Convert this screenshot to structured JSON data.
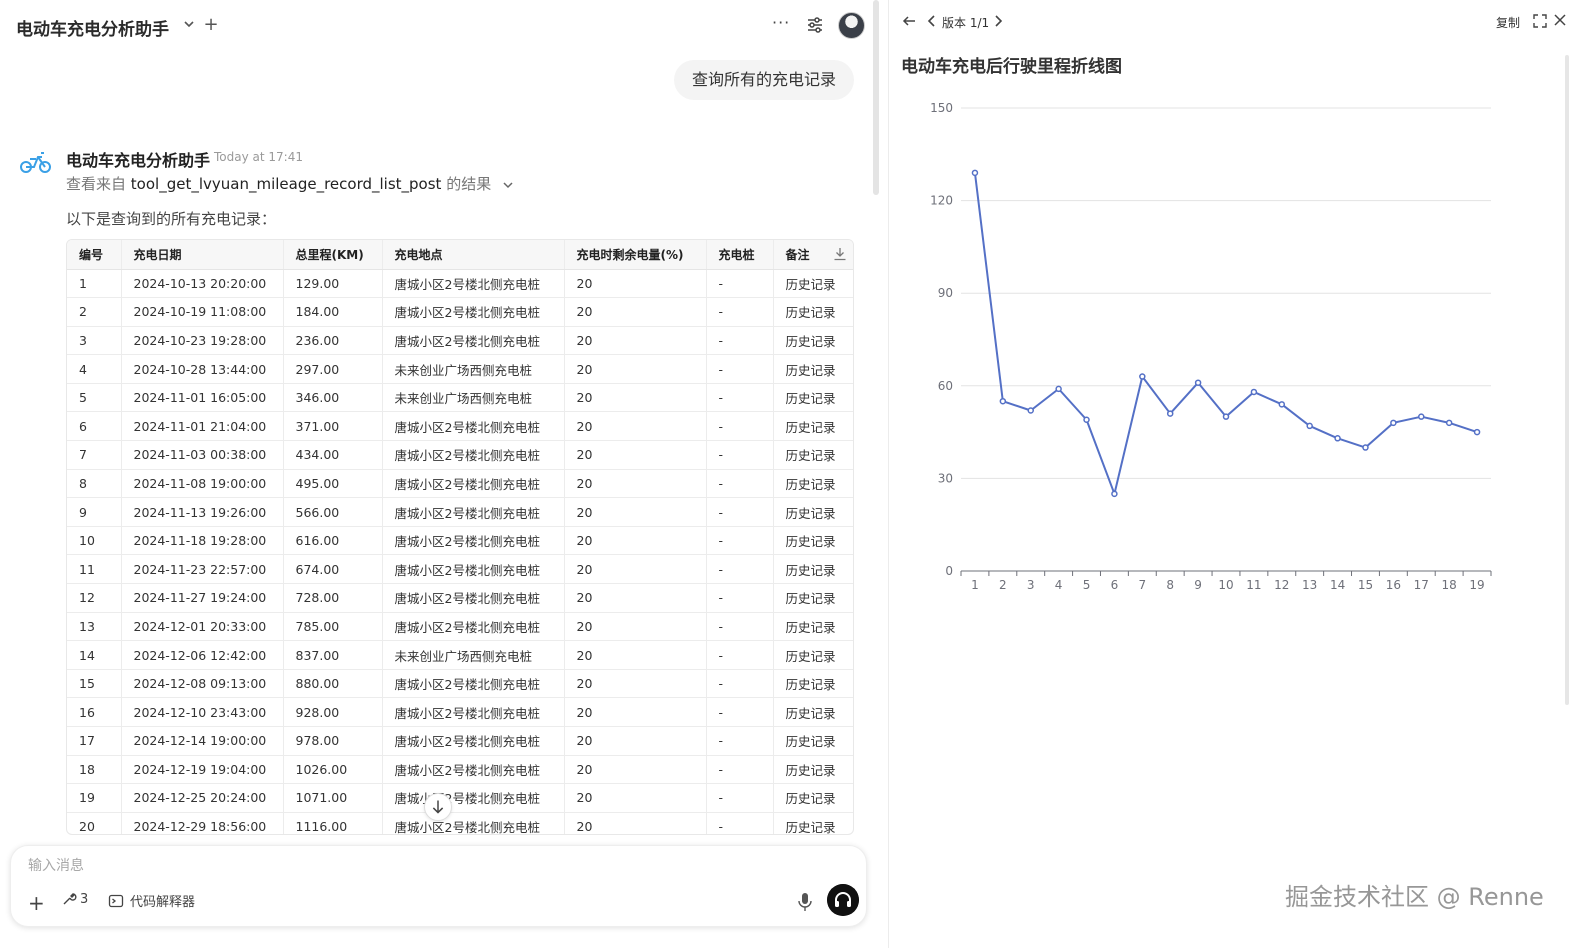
{
  "header": {
    "app_title": "电动车充电分析助手",
    "new_tab": "+",
    "more": "···"
  },
  "messages": {
    "user_query": "查询所有的充电记录",
    "bot_name": "电动车充电分析助手",
    "bot_time": "Today at 17:41",
    "tool_prefix": "查看来自",
    "tool_name": "tool_get_lvyuan_mileage_record_list_post",
    "tool_suffix": "的结果",
    "intro": "以下是查询到的所有充电记录："
  },
  "table": {
    "columns": [
      "编号",
      "充电日期",
      "总里程(KM)",
      "充电地点",
      "充电时剩余电量(%)",
      "充电桩",
      "备注"
    ],
    "rows": [
      [
        "1",
        "2024-10-13 20:20:00",
        "129.00",
        "唐城小区2号楼北侧充电桩",
        "20",
        "-",
        "历史记录"
      ],
      [
        "2",
        "2024-10-19 11:08:00",
        "184.00",
        "唐城小区2号楼北侧充电桩",
        "20",
        "-",
        "历史记录"
      ],
      [
        "3",
        "2024-10-23 19:28:00",
        "236.00",
        "唐城小区2号楼北侧充电桩",
        "20",
        "-",
        "历史记录"
      ],
      [
        "4",
        "2024-10-28 13:44:00",
        "297.00",
        "未来创业广场西侧充电桩",
        "20",
        "-",
        "历史记录"
      ],
      [
        "5",
        "2024-11-01 16:05:00",
        "346.00",
        "未来创业广场西侧充电桩",
        "20",
        "-",
        "历史记录"
      ],
      [
        "6",
        "2024-11-01 21:04:00",
        "371.00",
        "唐城小区2号楼北侧充电桩",
        "20",
        "-",
        "历史记录"
      ],
      [
        "7",
        "2024-11-03 00:38:00",
        "434.00",
        "唐城小区2号楼北侧充电桩",
        "20",
        "-",
        "历史记录"
      ],
      [
        "8",
        "2024-11-08 19:00:00",
        "495.00",
        "唐城小区2号楼北侧充电桩",
        "20",
        "-",
        "历史记录"
      ],
      [
        "9",
        "2024-11-13 19:26:00",
        "566.00",
        "唐城小区2号楼北侧充电桩",
        "20",
        "-",
        "历史记录"
      ],
      [
        "10",
        "2024-11-18 19:28:00",
        "616.00",
        "唐城小区2号楼北侧充电桩",
        "20",
        "-",
        "历史记录"
      ],
      [
        "11",
        "2024-11-23 22:57:00",
        "674.00",
        "唐城小区2号楼北侧充电桩",
        "20",
        "-",
        "历史记录"
      ],
      [
        "12",
        "2024-11-27 19:24:00",
        "728.00",
        "唐城小区2号楼北侧充电桩",
        "20",
        "-",
        "历史记录"
      ],
      [
        "13",
        "2024-12-01 20:33:00",
        "785.00",
        "唐城小区2号楼北侧充电桩",
        "20",
        "-",
        "历史记录"
      ],
      [
        "14",
        "2024-12-06 12:42:00",
        "837.00",
        "未来创业广场西侧充电桩",
        "20",
        "-",
        "历史记录"
      ],
      [
        "15",
        "2024-12-08 09:13:00",
        "880.00",
        "唐城小区2号楼北侧充电桩",
        "20",
        "-",
        "历史记录"
      ],
      [
        "16",
        "2024-12-10 23:43:00",
        "928.00",
        "唐城小区2号楼北侧充电桩",
        "20",
        "-",
        "历史记录"
      ],
      [
        "17",
        "2024-12-14 19:00:00",
        "978.00",
        "唐城小区2号楼北侧充电桩",
        "20",
        "-",
        "历史记录"
      ],
      [
        "18",
        "2024-12-19 19:04:00",
        "1026.00",
        "唐城小区2号楼北侧充电桩",
        "20",
        "-",
        "历史记录"
      ],
      [
        "19",
        "2024-12-25 20:24:00",
        "1071.00",
        "唐城小区2号楼北侧充电桩",
        "20",
        "-",
        "历史记录"
      ],
      [
        "20",
        "2024-12-29 18:56:00",
        "1116.00",
        "唐城小区2号楼北侧充电桩",
        "20",
        "-",
        "历史记录"
      ]
    ]
  },
  "composer": {
    "placeholder": "输入消息",
    "add": "+",
    "tools_count": "3",
    "code_interpreter": "代码解释器"
  },
  "artifact": {
    "version_label": "版本 1/1",
    "copy_label": "复制"
  },
  "chart_data": {
    "type": "line",
    "title": "电动车充电后行驶里程折线图",
    "xlabel": "",
    "ylabel": "",
    "categories": [
      "1",
      "2",
      "3",
      "4",
      "5",
      "6",
      "7",
      "8",
      "9",
      "10",
      "11",
      "12",
      "13",
      "14",
      "15",
      "16",
      "17",
      "18",
      "19"
    ],
    "values": [
      129,
      55,
      52,
      59,
      49,
      25,
      63,
      51,
      61,
      50,
      58,
      54,
      47,
      43,
      40,
      48,
      50,
      48,
      45
    ],
    "ylim": [
      0,
      150
    ],
    "yticks": [
      0,
      30,
      60,
      90,
      120,
      150
    ],
    "grid": true,
    "color": "#5470c6"
  },
  "watermark": "掘金技术社区 @ Renne"
}
